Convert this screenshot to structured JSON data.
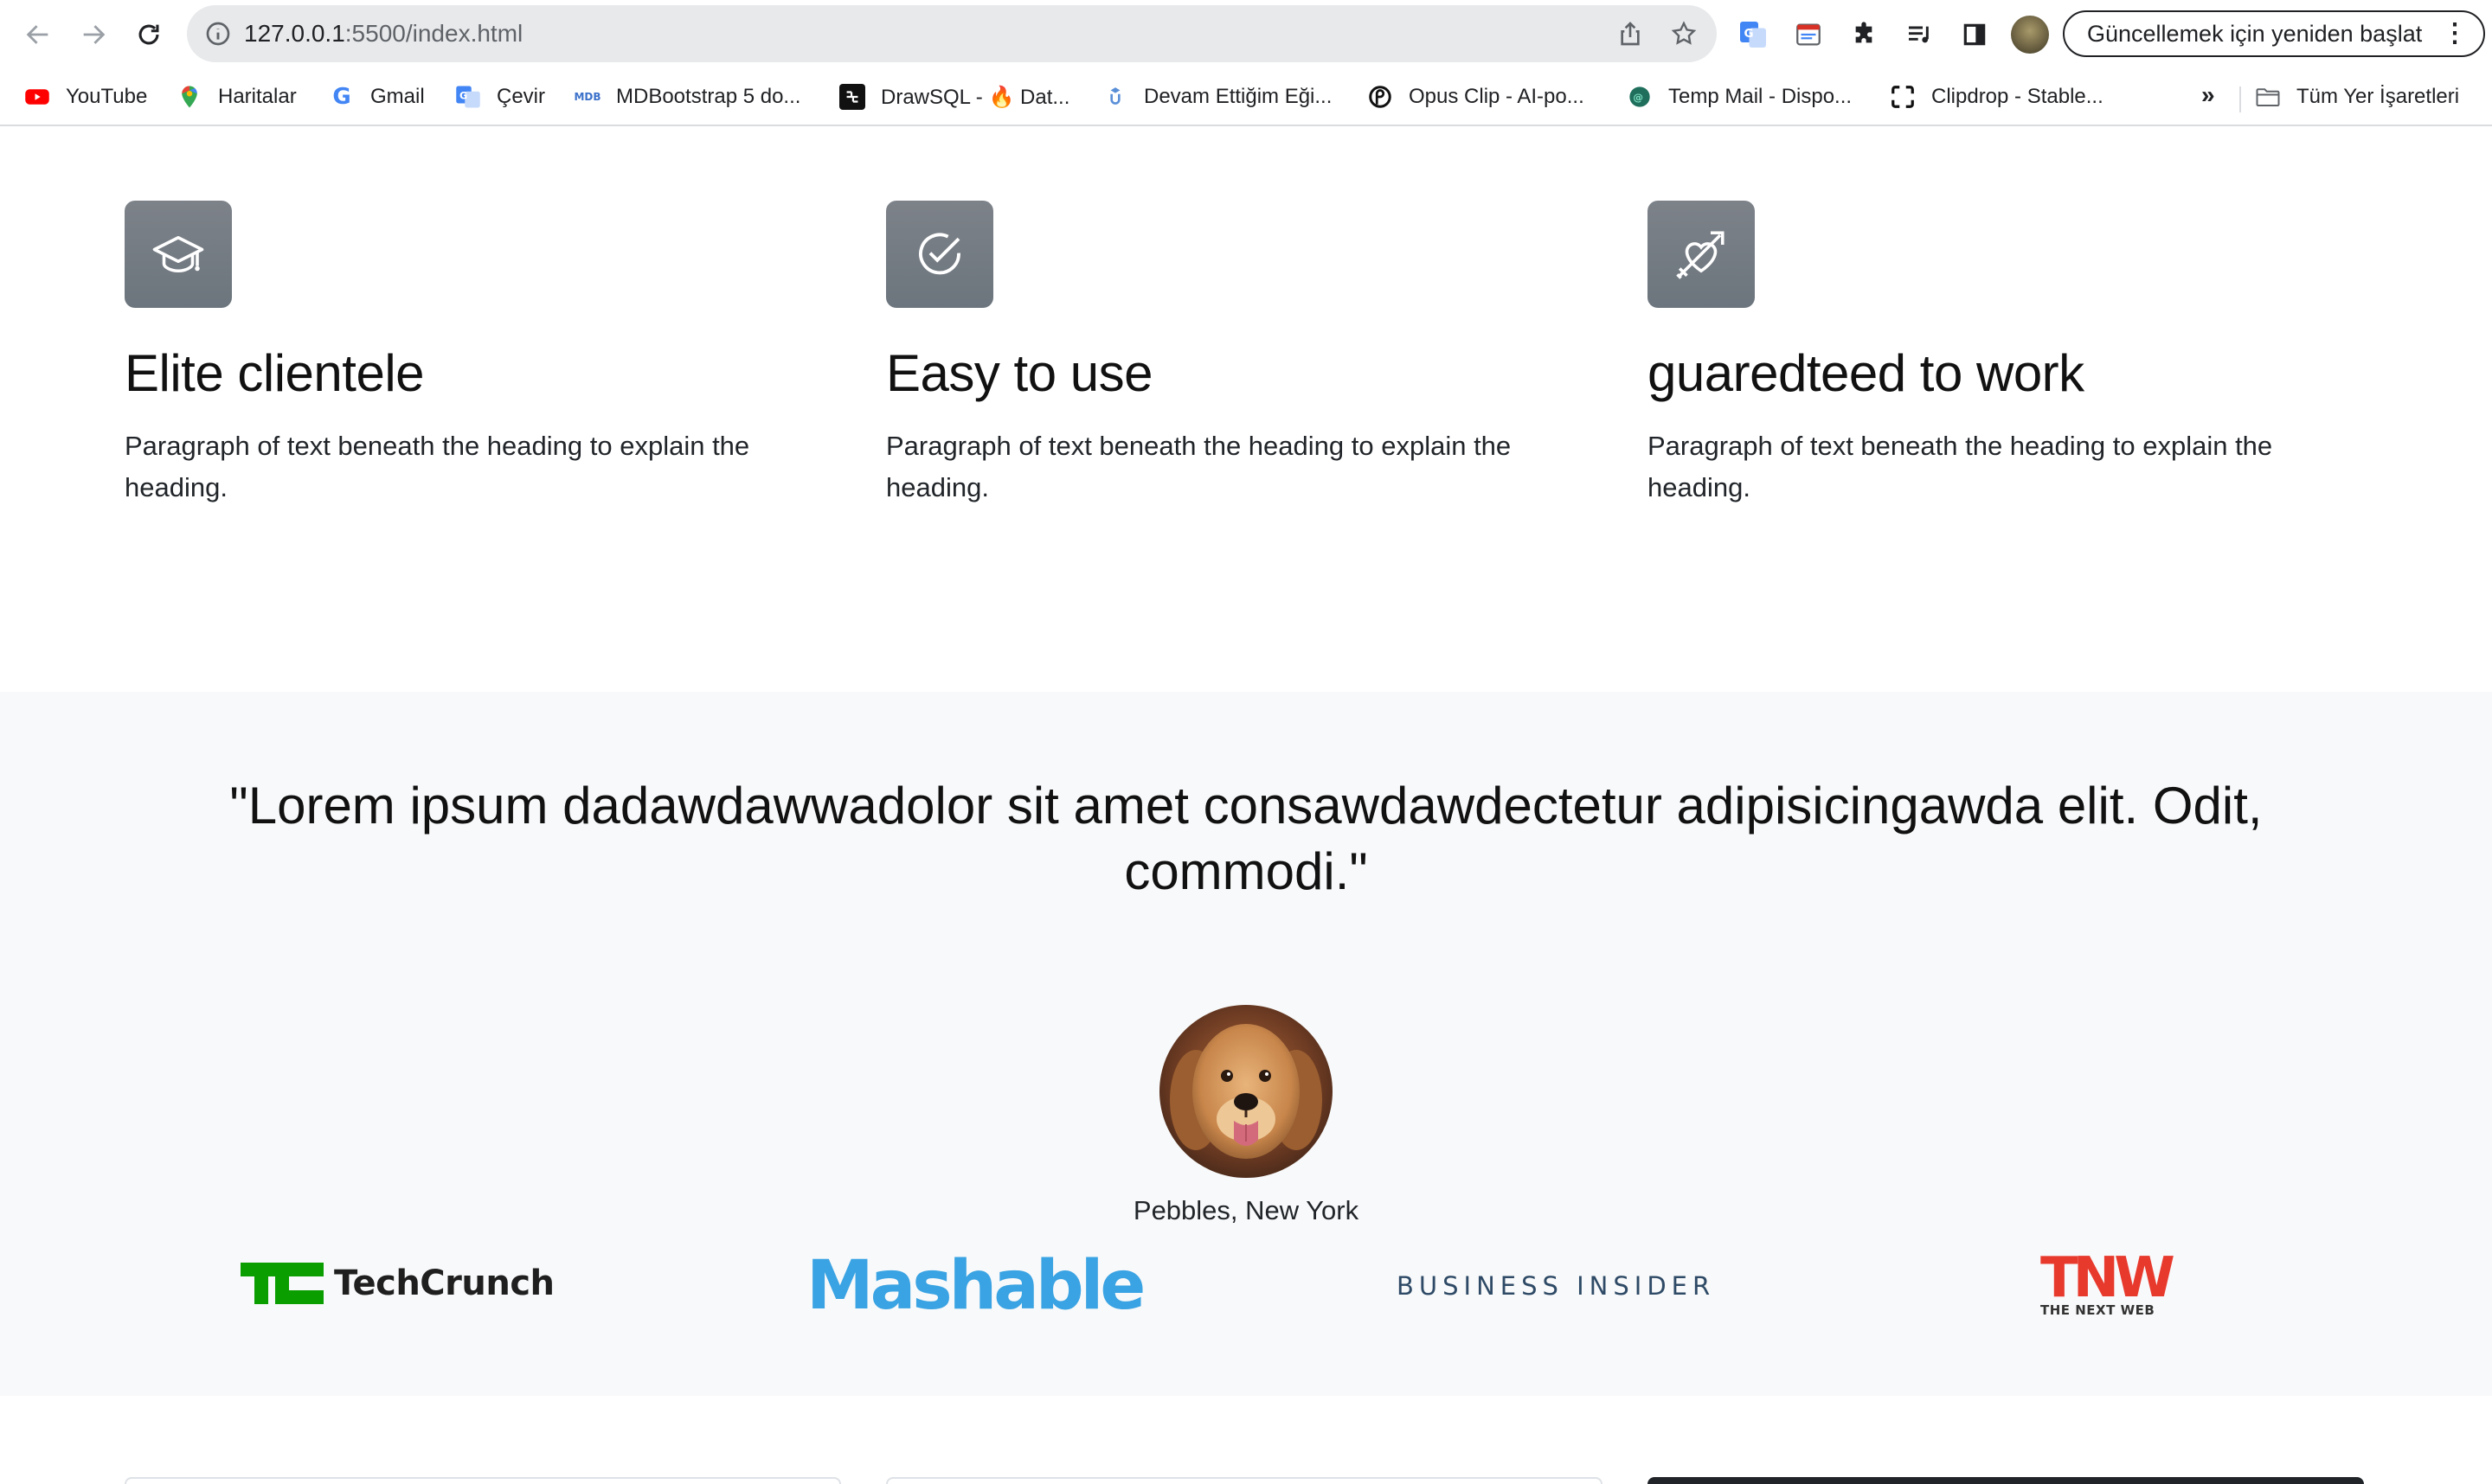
{
  "browser": {
    "url_host": "127.0.0.1",
    "url_rest": ":5500/index.html",
    "relaunch_label": "Güncellemek için yeniden başlat",
    "relaunch_menu": "⋮",
    "bookmarks": [
      {
        "label": "YouTube",
        "icon": "youtube-icon",
        "color": "#ff0000"
      },
      {
        "label": "Haritalar",
        "icon": "maps-icon",
        "color": "#34a853"
      },
      {
        "label": "Gmail",
        "icon": "google-icon",
        "color": "#4285f4"
      },
      {
        "label": "Çevir",
        "icon": "translate-icon",
        "color": "#4285f4"
      },
      {
        "label": "MDBootstrap 5 do...",
        "icon": "mdb-icon",
        "color": "#3b71ca"
      },
      {
        "label": "DrawSQL - 🔥 Dat...",
        "icon": "drawsql-icon",
        "color": "#111111"
      },
      {
        "label": "Devam Ettiğim Eği...",
        "icon": "udemy-icon",
        "color": "#a435f0"
      },
      {
        "label": "Opus Clip - AI-po...",
        "icon": "opusclip-icon",
        "color": "#111111"
      },
      {
        "label": "Temp Mail - Dispo...",
        "icon": "tempmail-icon",
        "color": "#1f6f5c"
      },
      {
        "label": "Clipdrop - Stable...",
        "icon": "clipdrop-icon",
        "color": "#111111"
      }
    ],
    "more_label": "»",
    "all_bookmarks_label": "Tüm Yer İşaretleri"
  },
  "features": [
    {
      "icon": "graduation-cap-icon",
      "title": "Elite clientele",
      "text": "Paragraph of text beneath the heading to explain the heading."
    },
    {
      "icon": "check-circle-icon",
      "title": "Easy to use",
      "text": "Paragraph of text beneath the heading to explain the heading."
    },
    {
      "icon": "heart-arrow-icon",
      "title": "guaredteed to work",
      "text": "Paragraph of text beneath the heading to explain the heading."
    }
  ],
  "testimonial": {
    "quote": "\"Lorem ipsum dadawdawwadolor sit amet consawdawdectetur adipisicingawda elit. Odit, commodi.\"",
    "author": "Pebbles, New York"
  },
  "press_logos": {
    "techcrunch": "TechCrunch",
    "mashable": "Mashable",
    "business_insider": "BUSINESS INSIDER",
    "tnw": "TNW",
    "tnw_sub": "THE NEXT WEB"
  },
  "colors": {
    "icon_bg": "#6c757d",
    "section_bg": "#f8f9fa",
    "techcrunch_green": "#0a9e01",
    "mashable_blue": "#3aa3e3",
    "tnw_red": "#e8392d"
  }
}
